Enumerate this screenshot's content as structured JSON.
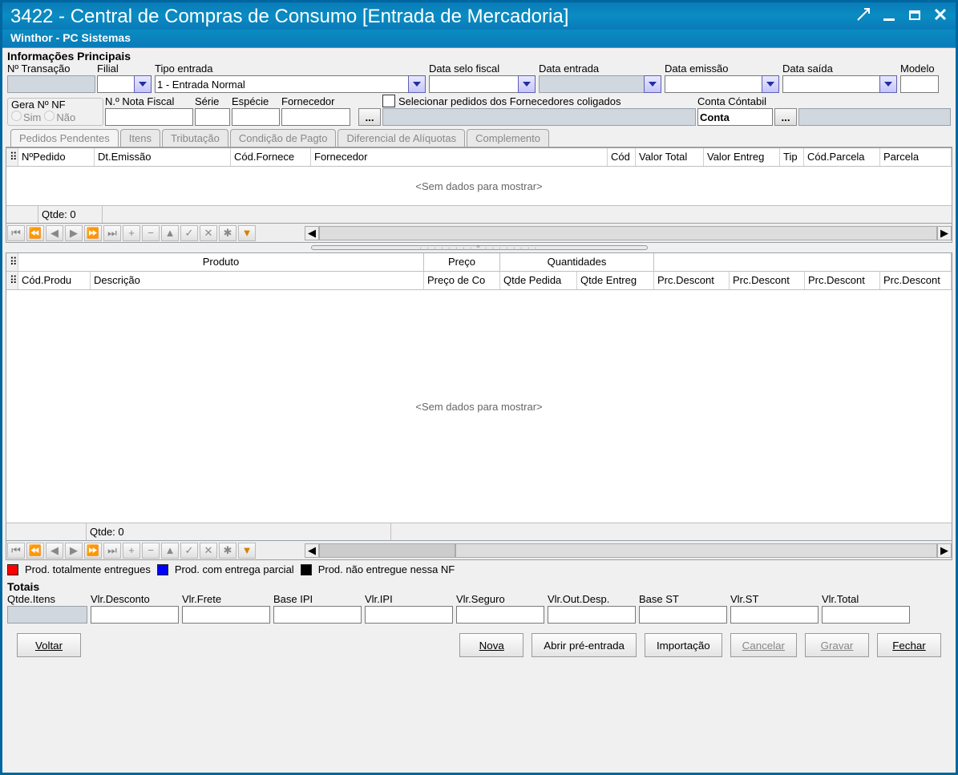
{
  "window": {
    "title": "3422 - Central de Compras de Consumo [Entrada de Mercadoria]",
    "subtitle": "Winthor - PC Sistemas"
  },
  "groups": {
    "info_principais": "Informações Principais",
    "gera_nf": "Gera Nº NF",
    "totais": "Totais"
  },
  "labels": {
    "n_transacao": "Nº Transação",
    "filial": "Filial",
    "tipo_entrada": "Tipo entrada",
    "data_selo_fiscal": "Data selo fiscal",
    "data_entrada": "Data entrada",
    "data_emissao": "Data emissão",
    "data_saida": "Data saída",
    "modelo": "Modelo",
    "sim": "Sim",
    "nao": "Não",
    "n_nota_fiscal": "N.º Nota Fiscal",
    "serie": "Série",
    "especie": "Espécie",
    "fornecedor": "Fornecedor",
    "selecionar_pedidos": "Selecionar pedidos dos Fornecedores coligados",
    "conta_contabil": "Conta Cóntabil",
    "conta": "Conta",
    "sem_dados": "<Sem dados para mostrar>",
    "qtde_prefix": "Qtde: ",
    "qtde_value": "0",
    "produto_band": "Produto",
    "preco_band": "Preço",
    "quantidades_band": "Quantidades"
  },
  "values": {
    "tipo_entrada": "1 - Entrada Normal"
  },
  "tabs": [
    "Pedidos Pendentes",
    "Itens",
    "Tributação",
    "Condição de Pagto",
    "Diferencial de Alíquotas",
    "Complemento"
  ],
  "grid1_cols": [
    "NºPedido",
    "Dt.Emissão",
    "Cód.Fornece",
    "Fornecedor",
    "Cód",
    "Valor Total",
    "Valor Entreg",
    "Tip",
    "Cód.Parcela",
    "Parcela"
  ],
  "grid2_cols": [
    "Cód.Produ",
    "Descrição",
    "Preço de Co",
    "Qtde Pedida",
    "Qtde Entreg",
    "Prc.Descont",
    "Prc.Descont",
    "Prc.Descont",
    "Prc.Descont"
  ],
  "legend": {
    "total": "Prod. totalmente entregues",
    "parcial": "Prod. com entrega parcial",
    "nao": "Prod. não entregue nessa NF"
  },
  "totals": [
    "Qtde.Itens",
    "Vlr.Desconto",
    "Vlr.Frete",
    "Base IPI",
    "Vlr.IPI",
    "Vlr.Seguro",
    "Vlr.Out.Desp.",
    "Base ST",
    "Vlr.ST",
    "Vlr.Total"
  ],
  "buttons": {
    "voltar": "Voltar",
    "nova": "Nova",
    "abrir_pre": "Abrir pré-entrada",
    "importacao": "Importação",
    "cancelar": "Cancelar",
    "gravar": "Gravar",
    "fechar": "Fechar"
  }
}
